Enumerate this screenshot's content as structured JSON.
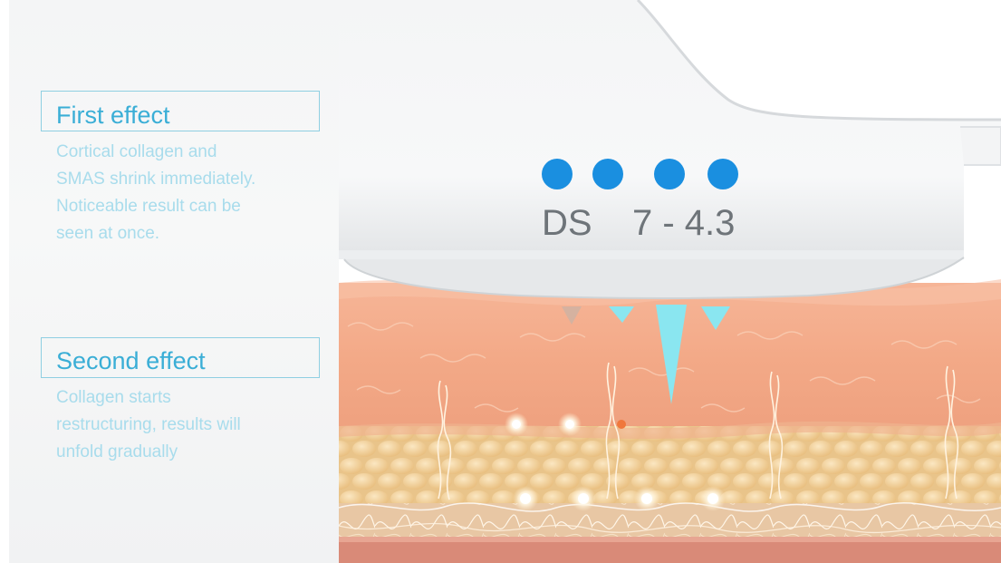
{
  "effects": [
    {
      "title": "First effect",
      "text": "Cortical collagen and\nSMAS shrink immediately.\nNoticeable result can be\nseen at once."
    },
    {
      "title": "Second effect",
      "text": "Collagen starts\nrestructuring, results will\nunfold gradually"
    }
  ],
  "device": {
    "label": "DS",
    "depth": "7 - 4.3",
    "indicator_count": 4,
    "indicator_color": "#1a8fe0"
  },
  "colors": {
    "accent": "#3aaed6",
    "body_text": "#a8dcec",
    "ultrasound": "#8ae6f0",
    "skin": "#f1a98a",
    "fat": "#f2d39e"
  }
}
